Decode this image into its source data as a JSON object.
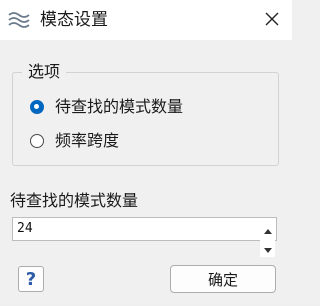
{
  "window": {
    "title": "模态设置",
    "app_icon": "wave-icon",
    "close_icon": "close-icon"
  },
  "options_group": {
    "legend": "选项",
    "radios": [
      {
        "label": "待查找的模式数量",
        "checked": true
      },
      {
        "label": "频率跨度",
        "checked": false
      }
    ]
  },
  "mode_count": {
    "label": "待查找的模式数量",
    "value": "24"
  },
  "buttons": {
    "help": "?",
    "ok": "确定"
  },
  "colors": {
    "accent": "#0067c0",
    "titlebar": "#ffffff",
    "background": "#f0f0f0"
  }
}
